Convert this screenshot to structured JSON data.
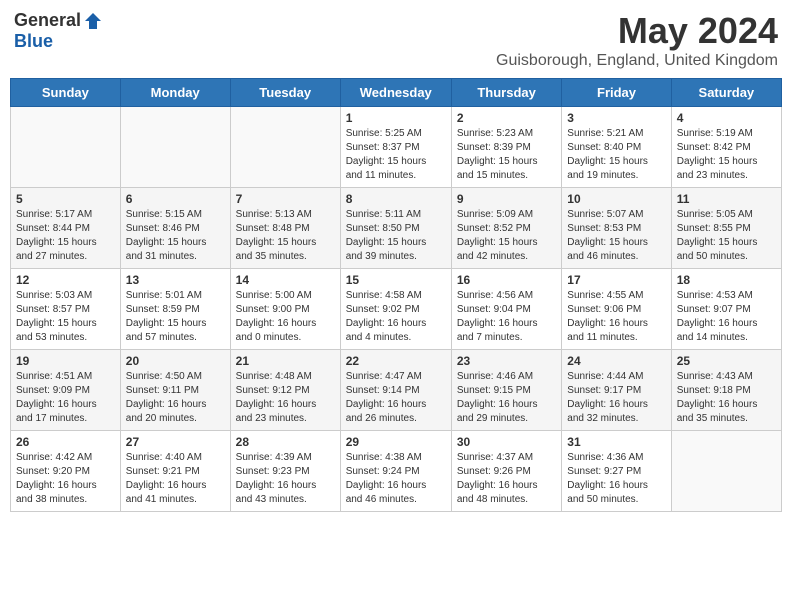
{
  "header": {
    "logo_general": "General",
    "logo_blue": "Blue",
    "month_title": "May 2024",
    "location": "Guisborough, England, United Kingdom"
  },
  "days_of_week": [
    "Sunday",
    "Monday",
    "Tuesday",
    "Wednesday",
    "Thursday",
    "Friday",
    "Saturday"
  ],
  "weeks": [
    [
      {
        "day": "",
        "info": ""
      },
      {
        "day": "",
        "info": ""
      },
      {
        "day": "",
        "info": ""
      },
      {
        "day": "1",
        "info": "Sunrise: 5:25 AM\nSunset: 8:37 PM\nDaylight: 15 hours\nand 11 minutes."
      },
      {
        "day": "2",
        "info": "Sunrise: 5:23 AM\nSunset: 8:39 PM\nDaylight: 15 hours\nand 15 minutes."
      },
      {
        "day": "3",
        "info": "Sunrise: 5:21 AM\nSunset: 8:40 PM\nDaylight: 15 hours\nand 19 minutes."
      },
      {
        "day": "4",
        "info": "Sunrise: 5:19 AM\nSunset: 8:42 PM\nDaylight: 15 hours\nand 23 minutes."
      }
    ],
    [
      {
        "day": "5",
        "info": "Sunrise: 5:17 AM\nSunset: 8:44 PM\nDaylight: 15 hours\nand 27 minutes."
      },
      {
        "day": "6",
        "info": "Sunrise: 5:15 AM\nSunset: 8:46 PM\nDaylight: 15 hours\nand 31 minutes."
      },
      {
        "day": "7",
        "info": "Sunrise: 5:13 AM\nSunset: 8:48 PM\nDaylight: 15 hours\nand 35 minutes."
      },
      {
        "day": "8",
        "info": "Sunrise: 5:11 AM\nSunset: 8:50 PM\nDaylight: 15 hours\nand 39 minutes."
      },
      {
        "day": "9",
        "info": "Sunrise: 5:09 AM\nSunset: 8:52 PM\nDaylight: 15 hours\nand 42 minutes."
      },
      {
        "day": "10",
        "info": "Sunrise: 5:07 AM\nSunset: 8:53 PM\nDaylight: 15 hours\nand 46 minutes."
      },
      {
        "day": "11",
        "info": "Sunrise: 5:05 AM\nSunset: 8:55 PM\nDaylight: 15 hours\nand 50 minutes."
      }
    ],
    [
      {
        "day": "12",
        "info": "Sunrise: 5:03 AM\nSunset: 8:57 PM\nDaylight: 15 hours\nand 53 minutes."
      },
      {
        "day": "13",
        "info": "Sunrise: 5:01 AM\nSunset: 8:59 PM\nDaylight: 15 hours\nand 57 minutes."
      },
      {
        "day": "14",
        "info": "Sunrise: 5:00 AM\nSunset: 9:00 PM\nDaylight: 16 hours\nand 0 minutes."
      },
      {
        "day": "15",
        "info": "Sunrise: 4:58 AM\nSunset: 9:02 PM\nDaylight: 16 hours\nand 4 minutes."
      },
      {
        "day": "16",
        "info": "Sunrise: 4:56 AM\nSunset: 9:04 PM\nDaylight: 16 hours\nand 7 minutes."
      },
      {
        "day": "17",
        "info": "Sunrise: 4:55 AM\nSunset: 9:06 PM\nDaylight: 16 hours\nand 11 minutes."
      },
      {
        "day": "18",
        "info": "Sunrise: 4:53 AM\nSunset: 9:07 PM\nDaylight: 16 hours\nand 14 minutes."
      }
    ],
    [
      {
        "day": "19",
        "info": "Sunrise: 4:51 AM\nSunset: 9:09 PM\nDaylight: 16 hours\nand 17 minutes."
      },
      {
        "day": "20",
        "info": "Sunrise: 4:50 AM\nSunset: 9:11 PM\nDaylight: 16 hours\nand 20 minutes."
      },
      {
        "day": "21",
        "info": "Sunrise: 4:48 AM\nSunset: 9:12 PM\nDaylight: 16 hours\nand 23 minutes."
      },
      {
        "day": "22",
        "info": "Sunrise: 4:47 AM\nSunset: 9:14 PM\nDaylight: 16 hours\nand 26 minutes."
      },
      {
        "day": "23",
        "info": "Sunrise: 4:46 AM\nSunset: 9:15 PM\nDaylight: 16 hours\nand 29 minutes."
      },
      {
        "day": "24",
        "info": "Sunrise: 4:44 AM\nSunset: 9:17 PM\nDaylight: 16 hours\nand 32 minutes."
      },
      {
        "day": "25",
        "info": "Sunrise: 4:43 AM\nSunset: 9:18 PM\nDaylight: 16 hours\nand 35 minutes."
      }
    ],
    [
      {
        "day": "26",
        "info": "Sunrise: 4:42 AM\nSunset: 9:20 PM\nDaylight: 16 hours\nand 38 minutes."
      },
      {
        "day": "27",
        "info": "Sunrise: 4:40 AM\nSunset: 9:21 PM\nDaylight: 16 hours\nand 41 minutes."
      },
      {
        "day": "28",
        "info": "Sunrise: 4:39 AM\nSunset: 9:23 PM\nDaylight: 16 hours\nand 43 minutes."
      },
      {
        "day": "29",
        "info": "Sunrise: 4:38 AM\nSunset: 9:24 PM\nDaylight: 16 hours\nand 46 minutes."
      },
      {
        "day": "30",
        "info": "Sunrise: 4:37 AM\nSunset: 9:26 PM\nDaylight: 16 hours\nand 48 minutes."
      },
      {
        "day": "31",
        "info": "Sunrise: 4:36 AM\nSunset: 9:27 PM\nDaylight: 16 hours\nand 50 minutes."
      },
      {
        "day": "",
        "info": ""
      }
    ]
  ]
}
